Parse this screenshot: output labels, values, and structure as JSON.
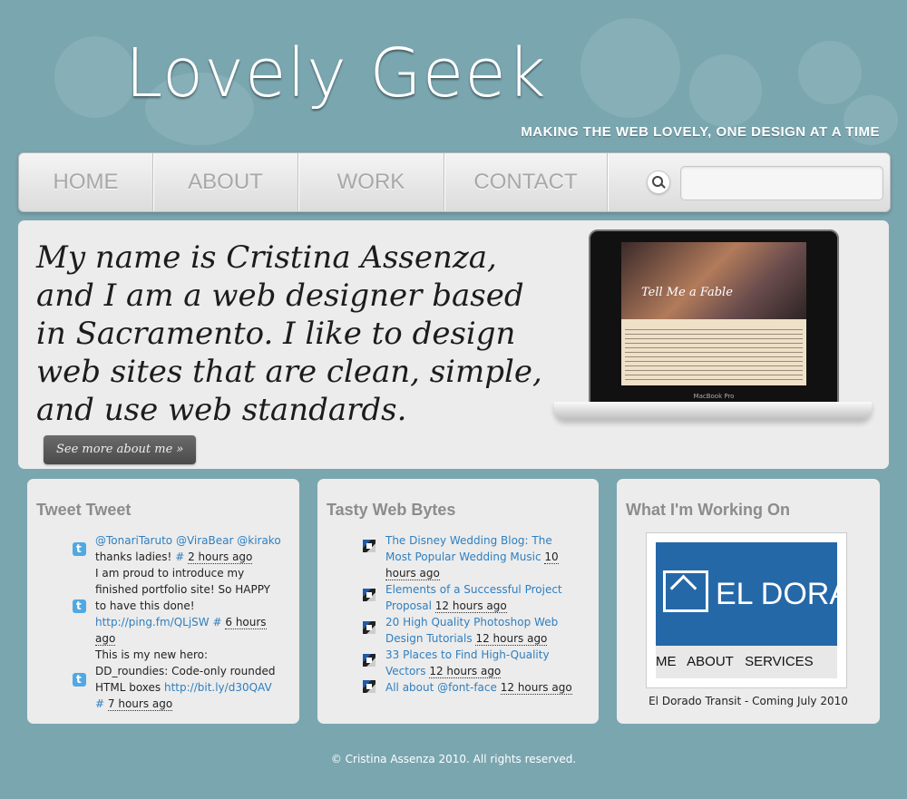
{
  "header": {
    "logo": "Lovely Geek",
    "tagline": "MAKING THE WEB LOVELY, ONE DESIGN AT A TIME"
  },
  "nav": {
    "items": [
      "HOME",
      "ABOUT",
      "WORK",
      "CONTACT"
    ],
    "search_value": ""
  },
  "hero": {
    "intro": "My name is Cristina Assenza, and I am a web designer based in Sacramento. I like to design web sites that are clean, simple, and use web standards.",
    "button": "See more about me »",
    "laptop_screen_title": "Tell Me a Fable",
    "laptop_label": "MacBook Pro"
  },
  "tweets": {
    "title": "Tweet Tweet",
    "items": [
      {
        "link": "@TonariTaruto @ViraBear @kirako",
        "text": " thanks ladies! ",
        "hash": "#",
        "time": "2 hours ago"
      },
      {
        "text": "I am proud to introduce my finished portfolio site! So HAPPY to have this done! ",
        "link": "http://ping.fm/QLjSW",
        "hash": "#",
        "time": "6 hours ago"
      },
      {
        "text": "This is my new hero: DD_roundies: Code-only rounded HTML boxes ",
        "link": "http://bit.ly/d30QAV",
        "hash": "#",
        "time": "7 hours ago"
      }
    ]
  },
  "bytes": {
    "title": "Tasty Web Bytes",
    "items": [
      {
        "link": "The Disney Wedding Blog: The Most Popular Wedding Music",
        "time": "10 hours ago"
      },
      {
        "link": "Elements of a Successful Project Proposal",
        "time": "12 hours ago"
      },
      {
        "link": "20 High Quality Photoshop Web Design Tutorials",
        "time": "12 hours ago"
      },
      {
        "link": "33 Places to Find High-Quality Vectors",
        "time": "12 hours ago"
      },
      {
        "link": "All about @font-face",
        "time": "12 hours ago"
      }
    ]
  },
  "working_on": {
    "title": "What I'm Working On",
    "project_name": "EL DORA",
    "project_nav": "ME   ABOUT   SERVICES",
    "caption": "El Dorado Transit - Coming July 2010"
  },
  "footer": "© Cristina Assenza 2010. All rights reserved."
}
